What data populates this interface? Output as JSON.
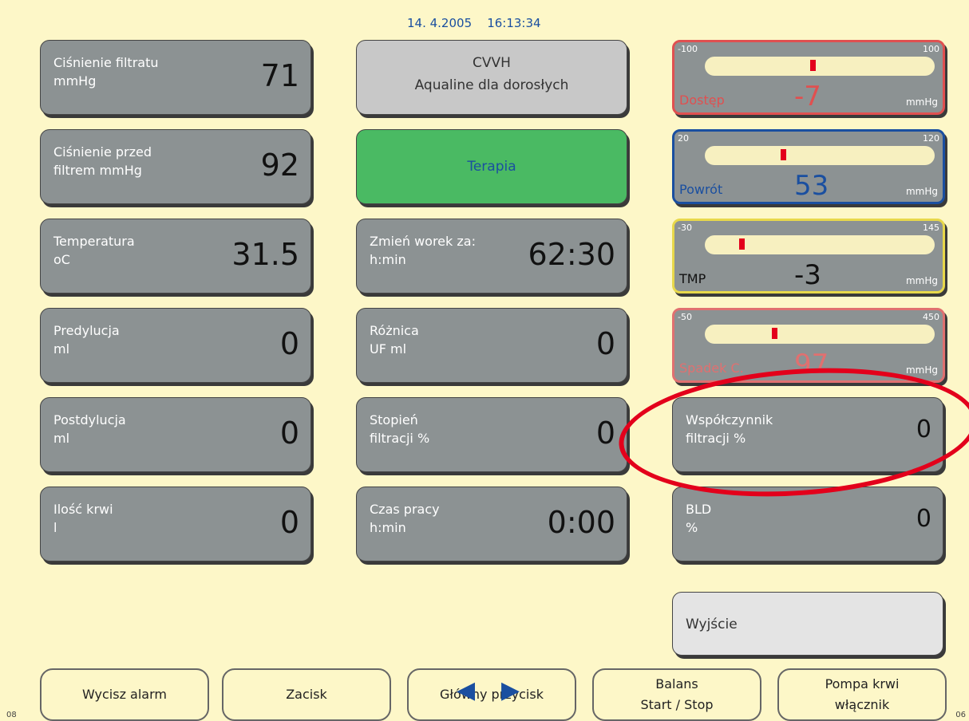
{
  "header": {
    "date": "14. 4.2005",
    "time": "16:13:34"
  },
  "left": [
    {
      "label": "Ciśnienie filtratu\nmmHg",
      "value": "71"
    },
    {
      "label": "Ciśnienie przed\nfiltrem mmHg",
      "value": "92"
    },
    {
      "label": "Temperatura\noC",
      "value": "31.5"
    },
    {
      "label": "Predylucja\nml",
      "value": "0"
    },
    {
      "label": "Postdylucja\nml",
      "value": "0"
    },
    {
      "label": "Ilość krwi\nl",
      "value": "0"
    }
  ],
  "center": {
    "mode_line1": "CVVH",
    "mode_line2": "Aqualine dla dorosłych",
    "therapy": "Terapia",
    "items": [
      {
        "label": "Zmień worek za:\nh:min",
        "value": "62:30"
      },
      {
        "label": "Różnica\nUF ml",
        "value": "0"
      },
      {
        "label": "Stopień\nfiltracji %",
        "value": "0"
      },
      {
        "label": "Czas pracy\nh:min",
        "value": "0:00"
      }
    ]
  },
  "gauges": [
    {
      "name": "Dostęp",
      "min": "-100",
      "max": "100",
      "value": "-7",
      "unit": "mmHg",
      "color": "#e05050",
      "level": 0.46
    },
    {
      "name": "Powrót",
      "min": "20",
      "max": "120",
      "value": "53",
      "unit": "mmHg",
      "color": "#1a4fa0",
      "level": 0.33
    },
    {
      "name": "TMP",
      "min": "-30",
      "max": "145",
      "value": "-3",
      "unit": "mmHg",
      "color": "#e8d84a",
      "level": 0.15
    },
    {
      "name": "Spadek C.",
      "min": "-50",
      "max": "450",
      "value": "97",
      "unit": "mmHg",
      "color": "#e07070",
      "level": 0.29
    }
  ],
  "right_items": [
    {
      "label": "Współczynnik\nfiltracji %",
      "value": "0"
    },
    {
      "label": "BLD\n%",
      "value": "0"
    }
  ],
  "exit": "Wyjście",
  "buttons": [
    "Wycisz alarm",
    "Zacisk",
    "Główny przycisk",
    "Balans\nStart / Stop",
    "Pompa krwi\nwłącznik"
  ],
  "corners": {
    "left": "08",
    "right": "06"
  },
  "colors": {
    "background": "#fdf7c8",
    "panel": "#8c9293",
    "therapy": "#4aba63",
    "highlight": "#e3001b"
  }
}
